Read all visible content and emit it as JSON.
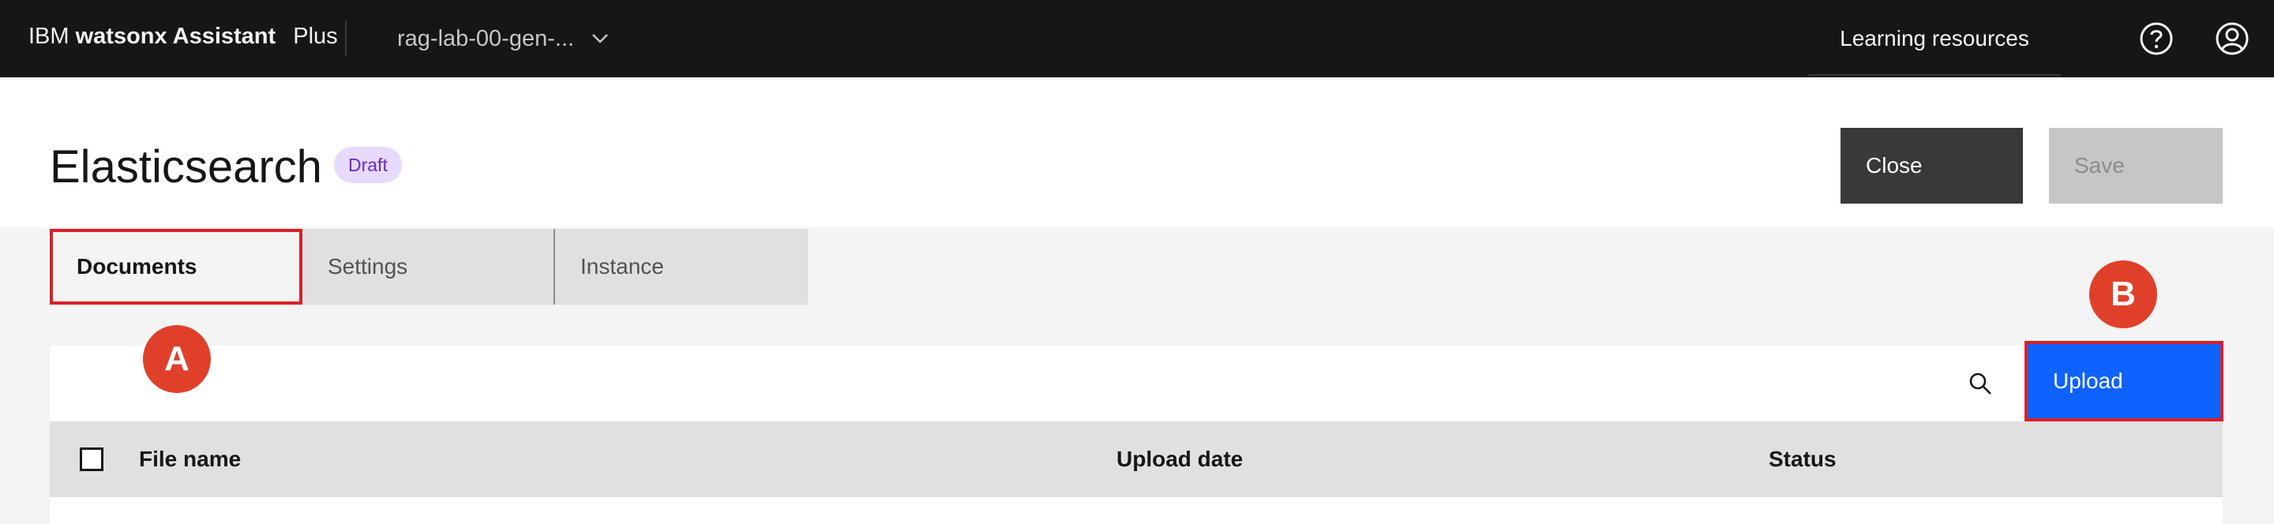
{
  "topbar": {
    "brand_prefix": "IBM",
    "brand_name": "watsonx Assistant",
    "plan": "Plus",
    "assistant_name": "rag-lab-00-gen-...",
    "learning_resources": "Learning resources",
    "icons": {
      "dropdown": "chevron-down-icon",
      "help": "help-icon",
      "user": "user-avatar-icon"
    }
  },
  "header": {
    "title": "Elasticsearch",
    "status_tag": "Draft",
    "close_label": "Close",
    "save_label": "Save"
  },
  "tabs": [
    {
      "label": "Documents",
      "selected": true
    },
    {
      "label": "Settings",
      "selected": false
    },
    {
      "label": "Instance",
      "selected": false
    }
  ],
  "toolbar": {
    "upload_label": "Upload",
    "search_icon": "search-icon"
  },
  "table": {
    "columns": [
      "File name",
      "Upload date",
      "Status"
    ],
    "rows": []
  },
  "annotations": {
    "marker_a": "A",
    "marker_b": "B"
  },
  "colors": {
    "topbar_bg": "#161616",
    "primary": "#0f62fe",
    "highlight": "#da1e28",
    "marker": "#e0402a",
    "draft_tag_bg": "#e8daff",
    "draft_tag_text": "#6929c4"
  }
}
